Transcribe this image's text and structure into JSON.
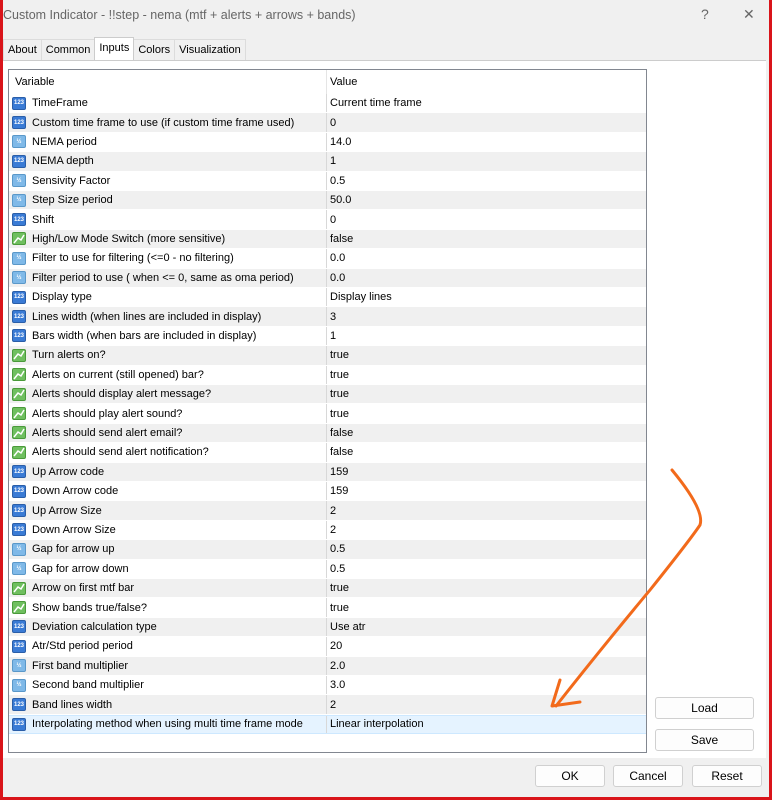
{
  "window": {
    "title": "Custom Indicator - !!step - nema (mtf + alerts + arrows + bands)",
    "help": "?",
    "close": "✕"
  },
  "tabs": [
    "About",
    "Common",
    "Inputs",
    "Colors",
    "Visualization"
  ],
  "active_tab": "Inputs",
  "grid": {
    "headers": {
      "variable": "Variable",
      "value": "Value"
    },
    "rows": [
      {
        "type": "int",
        "name": "TimeFrame",
        "value": "Current time frame"
      },
      {
        "type": "int",
        "name": "Custom time frame to use (if custom time frame used)",
        "value": "0"
      },
      {
        "type": "dbl",
        "name": "NEMA period",
        "value": "14.0"
      },
      {
        "type": "int",
        "name": "NEMA depth",
        "value": "1"
      },
      {
        "type": "dbl",
        "name": "Sensivity Factor",
        "value": "0.5"
      },
      {
        "type": "dbl",
        "name": "Step Size period",
        "value": "50.0"
      },
      {
        "type": "int",
        "name": "Shift",
        "value": "0"
      },
      {
        "type": "bool",
        "name": "High/Low Mode Switch (more sensitive)",
        "value": "false"
      },
      {
        "type": "dbl",
        "name": "Filter to use for filtering (<=0 - no filtering)",
        "value": "0.0"
      },
      {
        "type": "dbl",
        "name": "Filter period to use ( when <= 0, same as oma period)",
        "value": "0.0"
      },
      {
        "type": "int",
        "name": "Display type",
        "value": "Display lines"
      },
      {
        "type": "int",
        "name": "Lines width (when lines are included in display)",
        "value": "3"
      },
      {
        "type": "int",
        "name": "Bars width (when bars are included in display)",
        "value": "1"
      },
      {
        "type": "bool",
        "name": "Turn alerts on?",
        "value": "true"
      },
      {
        "type": "bool",
        "name": "Alerts on current (still opened) bar?",
        "value": "true"
      },
      {
        "type": "bool",
        "name": "Alerts should display alert message?",
        "value": "true"
      },
      {
        "type": "bool",
        "name": "Alerts should play alert sound?",
        "value": "true"
      },
      {
        "type": "bool",
        "name": "Alerts should send alert email?",
        "value": "false"
      },
      {
        "type": "bool",
        "name": "Alerts should send alert notification?",
        "value": "false"
      },
      {
        "type": "int",
        "name": "Up Arrow code",
        "value": "159"
      },
      {
        "type": "int",
        "name": "Down Arrow code",
        "value": "159"
      },
      {
        "type": "int",
        "name": "Up Arrow Size",
        "value": "2"
      },
      {
        "type": "int",
        "name": "Down Arrow Size",
        "value": "2"
      },
      {
        "type": "dbl",
        "name": "Gap for arrow up",
        "value": "0.5"
      },
      {
        "type": "dbl",
        "name": "Gap for arrow down",
        "value": "0.5"
      },
      {
        "type": "bool",
        "name": "Arrow on first mtf bar",
        "value": "true"
      },
      {
        "type": "bool",
        "name": "Show bands true/false?",
        "value": "true"
      },
      {
        "type": "int",
        "name": "Deviation calculation type",
        "value": "Use atr"
      },
      {
        "type": "int",
        "name": "Atr/Std period period",
        "value": "20"
      },
      {
        "type": "dbl",
        "name": "First band multiplier",
        "value": "2.0"
      },
      {
        "type": "dbl",
        "name": "Second band multiplier",
        "value": "3.0"
      },
      {
        "type": "int",
        "name": "Band lines width",
        "value": "2"
      },
      {
        "type": "int",
        "name": "Interpolating method when using multi time frame mode",
        "value": "Linear interpolation"
      }
    ]
  },
  "icons": {
    "int": "123",
    "dbl": "½",
    "bool": "chart"
  },
  "buttons": {
    "load": "Load",
    "save": "Save",
    "ok": "OK",
    "cancel": "Cancel",
    "reset": "Reset"
  },
  "annotation_color": "#f26a1b"
}
